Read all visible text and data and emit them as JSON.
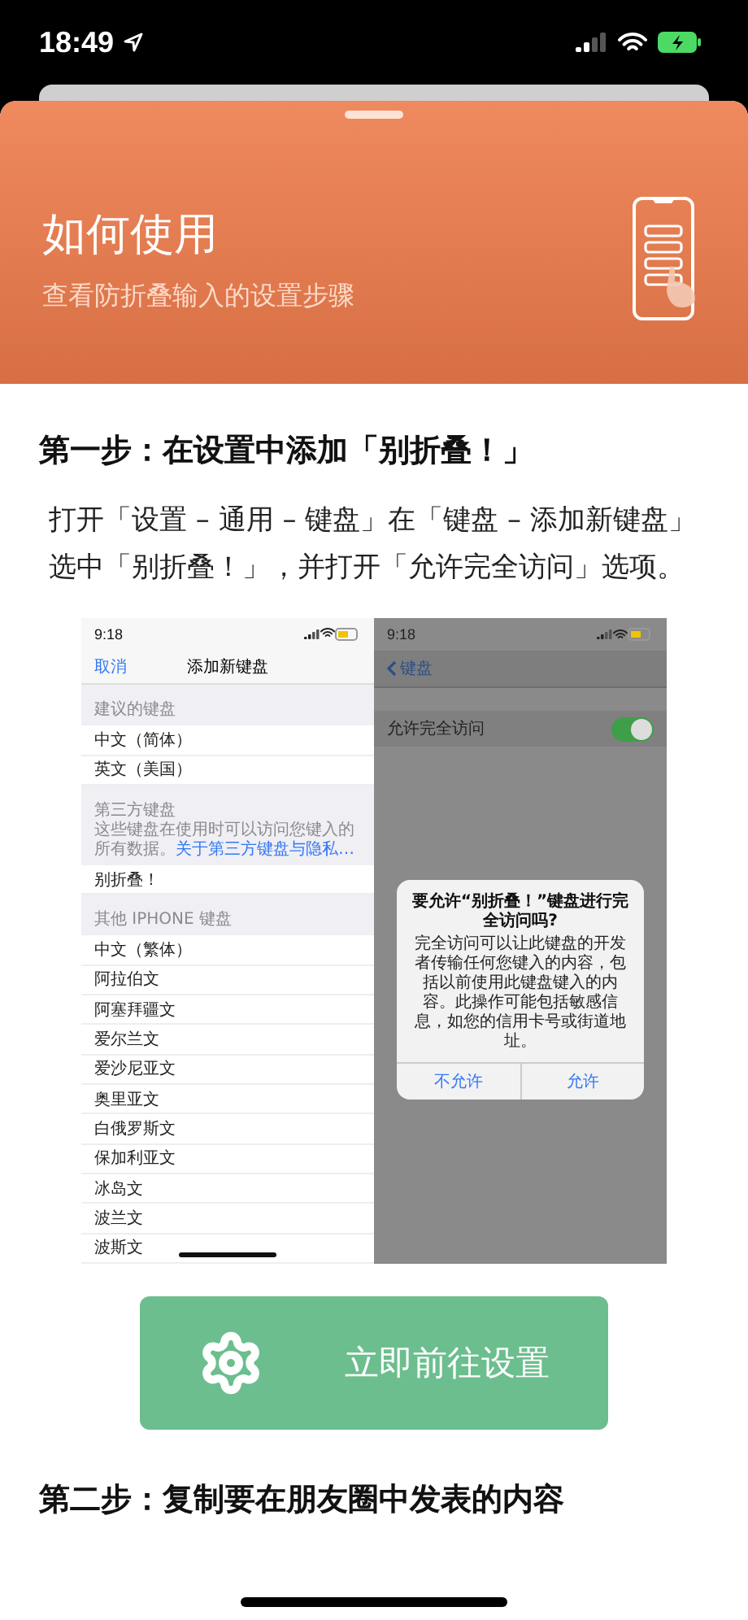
{
  "status_bar": {
    "time": "18:49"
  },
  "header": {
    "title": "如何使用",
    "subtitle": "查看防折叠输入的设置步骤"
  },
  "steps": [
    {
      "title": "第一步：在设置中添加「别折叠！」",
      "description": "打开「设置 – 通用 – 键盘」在「键盘 – 添加新键盘」选中「别折叠！」，并打开「允许完全访问」选项。",
      "screenshot": {
        "left": {
          "time": "9:18",
          "cancel": "取消",
          "title": "添加新键盘",
          "sections": [
            {
              "header": "建议的键盘",
              "rows": [
                "中文（简体）",
                "英文（美国）"
              ]
            },
            {
              "header": "第三方键盘",
              "note": "这些键盘在使用时可以访问您键入的所有数据。",
              "link": "关于第三方键盘与隐私…",
              "rows": [
                "别折叠！"
              ]
            },
            {
              "header": "其他 IPHONE 键盘",
              "rows": [
                "中文（繁体）",
                "阿拉伯文",
                "阿塞拜疆文",
                "爱尔兰文",
                "爱沙尼亚文",
                "奥里亚文",
                "白俄罗斯文",
                "保加利亚文",
                "冰岛文",
                "波兰文",
                "波斯文"
              ]
            }
          ]
        },
        "right": {
          "time": "9:18",
          "back": "键盘",
          "setting": {
            "label": "允许完全访问",
            "on": true
          },
          "alert": {
            "title": "要允许“别折叠！”键盘进行完全访问吗?",
            "message": "完全访问可以让此键盘的开发者传输任何您键入的内容，包括以前使用此键盘键入的内容。此操作可能包括敏感信息，如您的信用卡号或街道地址。",
            "buttons": [
              "不允许",
              "允许"
            ]
          }
        }
      },
      "button": "立即前往设置"
    },
    {
      "title": "第二步：复制要在朋友圈中发表的内容"
    }
  ]
}
